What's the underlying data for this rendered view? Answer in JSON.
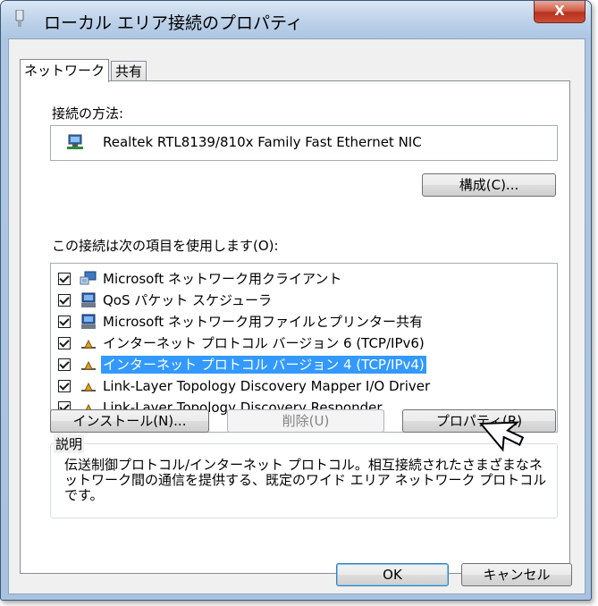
{
  "window": {
    "title": "ローカル エリア接続のプロパティ",
    "close_label": "X"
  },
  "tabs": [
    {
      "label": "ネットワーク",
      "active": true
    },
    {
      "label": "共有",
      "active": false
    }
  ],
  "connection": {
    "label": "接続の方法:",
    "adapter_name": "Realtek RTL8139/810x Family Fast Ethernet NIC",
    "configure_label": "構成(C)..."
  },
  "items_label": "この接続は次の項目を使用します(O):",
  "items": [
    {
      "label": "Microsoft ネットワーク用クライアント",
      "checked": true,
      "icon": "client-icon",
      "selected": false
    },
    {
      "label": "QoS パケット スケジューラ",
      "checked": true,
      "icon": "qos-icon",
      "selected": false
    },
    {
      "label": "Microsoft ネットワーク用ファイルとプリンター共有",
      "checked": true,
      "icon": "sharing-icon",
      "selected": false
    },
    {
      "label": "インターネット プロトコル バージョン 6 (TCP/IPv6)",
      "checked": true,
      "icon": "protocol-icon",
      "selected": false
    },
    {
      "label": "インターネット プロトコル バージョン 4 (TCP/IPv4)",
      "checked": true,
      "icon": "protocol-icon",
      "selected": true
    },
    {
      "label": "Link-Layer Topology Discovery Mapper I/O Driver",
      "checked": true,
      "icon": "protocol-icon",
      "selected": false
    },
    {
      "label": "Link-Layer Topology Discovery Responder",
      "checked": true,
      "icon": "protocol-icon",
      "selected": false
    }
  ],
  "buttons": {
    "install": "インストール(N)...",
    "uninstall": "削除(U)",
    "properties": "プロパティ(R)",
    "ok": "OK",
    "cancel": "キャンセル"
  },
  "description": {
    "legend": "説明",
    "text": "伝送制御プロトコル/インターネット プロトコル。相互接続されたさまざまなネットワーク間の通信を提供する、既定のワイド エリア ネットワーク プロトコルです。"
  },
  "colors": {
    "selection": "#3399ff",
    "close_button": "#c94e36",
    "frame": "#aec6e3"
  }
}
